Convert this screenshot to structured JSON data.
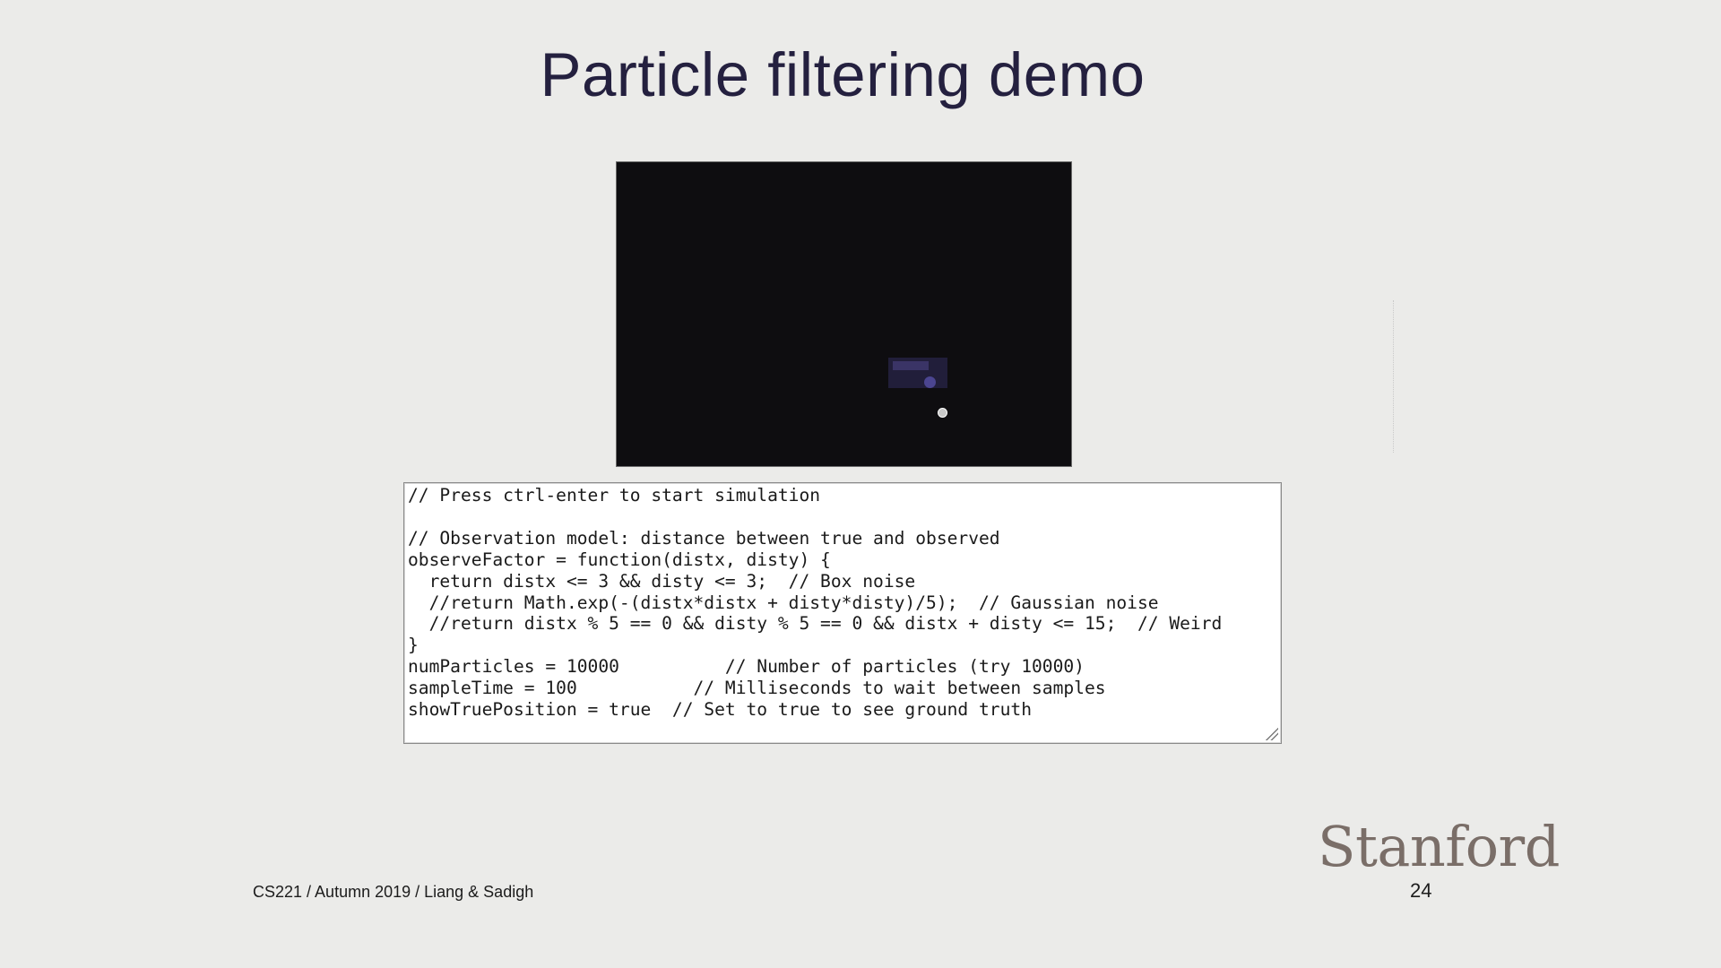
{
  "slide": {
    "title": "Particle filtering demo",
    "footer": "CS221 / Autumn 2019 / Liang & Sadigh",
    "logo_text": "Stanford",
    "page_number": "24"
  },
  "editor": {
    "lines": [
      "// Press ctrl-enter to start simulation",
      "",
      "// Observation model: distance between true and observed",
      "observeFactor = function(distx, disty) {",
      "  return distx <= 3 && disty <= 3;  // Box noise",
      "  //return Math.exp(-(distx*distx + disty*disty)/5);  // Gaussian noise",
      "  //return distx % 5 == 0 && disty % 5 == 0 && distx + disty <= 15;  // Weird",
      "}",
      "numParticles = 10000          // Number of particles (try 10000)",
      "sampleTime = 100           // Milliseconds to wait between samples",
      "showTruePosition = true  // Set to true to see ground truth"
    ]
  },
  "colors": {
    "background": "#ebebe9",
    "title": "#24203f",
    "canvas": "#0e0d10",
    "particles": "#24203f",
    "estimate": "#4b4590",
    "true_position": "#c8c8c8",
    "logo": "#7a6e68"
  }
}
